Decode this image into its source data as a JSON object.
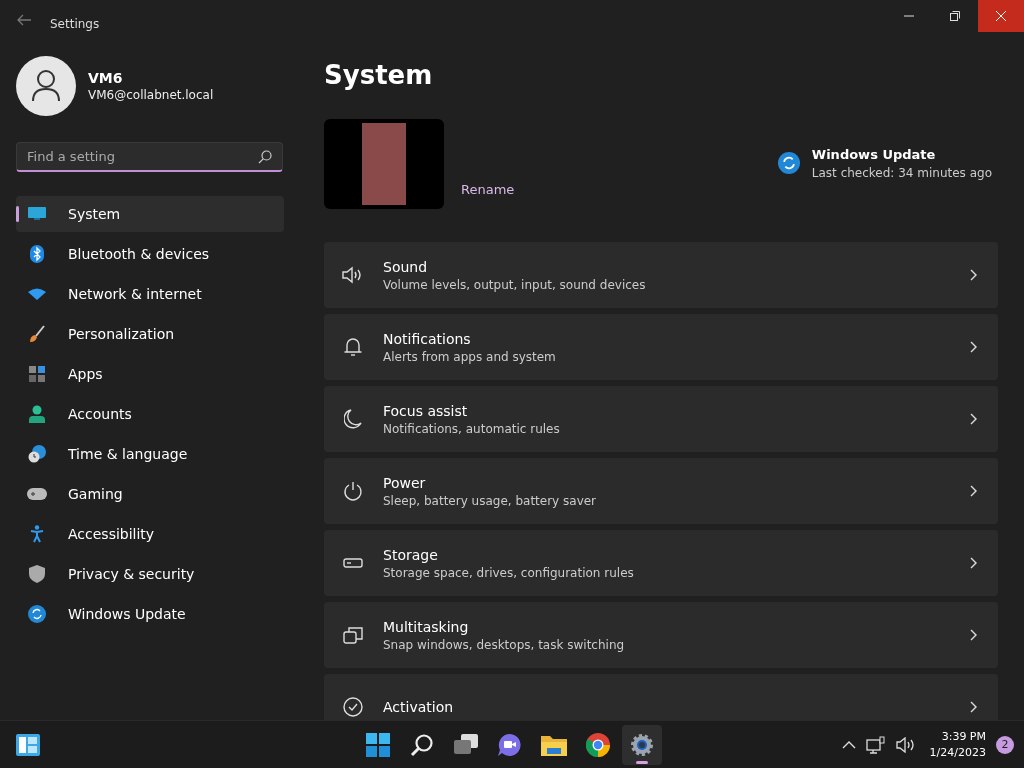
{
  "window": {
    "title": "Settings"
  },
  "profile": {
    "name": "VM6",
    "email": "VM6@collabnet.local"
  },
  "search": {
    "placeholder": "Find a setting"
  },
  "nav": [
    {
      "label": "System",
      "selected": true
    },
    {
      "label": "Bluetooth & devices",
      "selected": false
    },
    {
      "label": "Network & internet",
      "selected": false
    },
    {
      "label": "Personalization",
      "selected": false
    },
    {
      "label": "Apps",
      "selected": false
    },
    {
      "label": "Accounts",
      "selected": false
    },
    {
      "label": "Time & language",
      "selected": false
    },
    {
      "label": "Gaming",
      "selected": false
    },
    {
      "label": "Accessibility",
      "selected": false
    },
    {
      "label": "Privacy & security",
      "selected": false
    },
    {
      "label": "Windows Update",
      "selected": false
    }
  ],
  "page_title": "System",
  "device": {
    "rename": "Rename"
  },
  "update": {
    "title": "Windows Update",
    "status": "Last checked: 34 minutes ago"
  },
  "cards": [
    {
      "title": "Sound",
      "subtitle": "Volume levels, output, input, sound devices"
    },
    {
      "title": "Notifications",
      "subtitle": "Alerts from apps and system"
    },
    {
      "title": "Focus assist",
      "subtitle": "Notifications, automatic rules"
    },
    {
      "title": "Power",
      "subtitle": "Sleep, battery usage, battery saver"
    },
    {
      "title": "Storage",
      "subtitle": "Storage space, drives, configuration rules"
    },
    {
      "title": "Multitasking",
      "subtitle": "Snap windows, desktops, task switching"
    },
    {
      "title": "Activation"
    }
  ],
  "taskbar": {
    "apps": [
      {
        "active": false
      },
      {
        "active": false
      },
      {
        "active": false
      },
      {
        "active": false
      },
      {
        "active": false
      },
      {
        "active": false
      },
      {
        "active": true
      }
    ],
    "time": "3:39 PM",
    "date": "1/24/2023",
    "notifications": "2"
  }
}
